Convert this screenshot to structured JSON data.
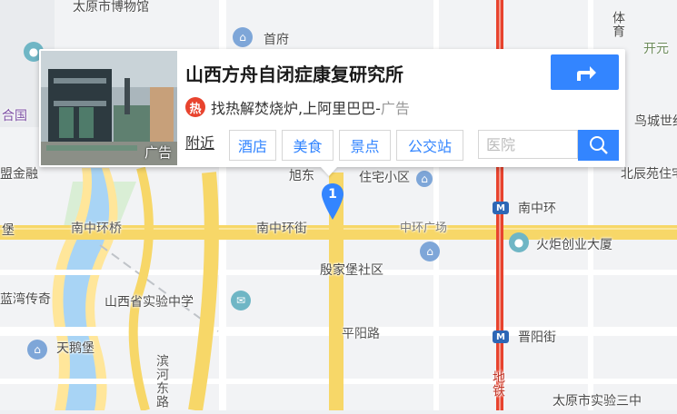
{
  "map": {
    "labels": {
      "top_museum": "太原市博物馆",
      "shengfu": "首府",
      "tiyu": "体育",
      "kaiyuan": "开元",
      "he_gu": "合",
      "he_gu2": "合国",
      "golden_fusion": "盟金融",
      "zhuzhai": "住宅小区",
      "xudong": "旭东",
      "niaocheng": "鸟城世纪",
      "beichen": "北辰苑住宅",
      "nanzhonghuan_bridge": "南中环桥",
      "nanzhonghuan_street": "南中环街",
      "zhonghuan_square": "中环广场",
      "nanzhonghuan_metro": "南中环",
      "huoju": "火炬创业大厦",
      "yinjiabao": "殷家堡社区",
      "lanwan": "蓝湾传奇",
      "shanxi_school": "山西省实验中学",
      "tiane": "天鹅堡",
      "pingyang": "平阳路",
      "jinyang_street": "晋阳街",
      "binhe_east": "滨河东路",
      "ditie": "地铁",
      "school_3": "太原市实验三中",
      "left_edge_road": "堡"
    }
  },
  "card": {
    "title": "山西方舟自闭症康复研究所",
    "thumb_ad_tag": "广告",
    "hot_icon_char": "热",
    "ad_text": "找热解焚烧炉,上阿里巴巴-",
    "ad_suffix": "广告",
    "nearby_label": "附近",
    "chips": [
      "酒店",
      "美食",
      "景点",
      "公交站"
    ],
    "search_placeholder": "医院",
    "route_icon": "route-turn-icon",
    "search_icon": "search-icon"
  },
  "marker": {
    "number": "1",
    "color": "#3385ff"
  },
  "colors": {
    "accent": "#3385ff",
    "river": "#a8d4f5",
    "major_road": "#f7d768",
    "metro_line": "#e8432e",
    "green": "#c8e8c4"
  }
}
